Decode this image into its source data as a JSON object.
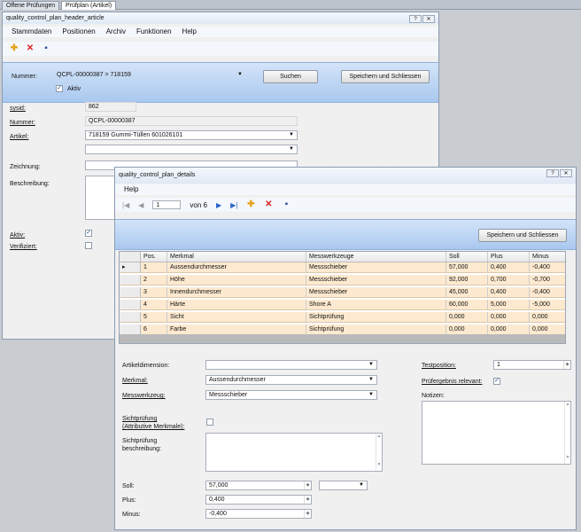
{
  "tabs": [
    {
      "label": "Offene Prüfungen"
    },
    {
      "label": "Prüfplan (Artikel)"
    }
  ],
  "header_window": {
    "title": "quality_control_plan_header_article",
    "title_buttons": [
      "?",
      "✕"
    ],
    "menu": [
      "Stammdaten",
      "Positionen",
      "Archiv",
      "Funktionen",
      "Help"
    ],
    "toolbar_icons": [
      "add-icon",
      "delete-icon",
      "save-icon"
    ],
    "nummer_label": "Nummer:",
    "nummer_value": "QCPL-00000387 > 718159",
    "aktiv_label": "Aktiv",
    "aktiv_checked": true,
    "search_button": "Suchen",
    "save_close_button": "Speichern und Schliessen",
    "form": {
      "sysid_label": "sysid:",
      "sysid_value": "862",
      "nummer_label": "Nummer:",
      "nummer_value": "QCPL-00000387",
      "artikel_label": "Artikel:",
      "artikel_value": "718159    Gummi-Tüllen 601026101",
      "artikel2_value": "",
      "zeichnung_label": "Zeichnung:",
      "beschreibung_label": "Beschreibung:",
      "aktiv_label": "Aktiv:",
      "aktiv_checked": true,
      "verifiziert_label": "Verifiziert:",
      "verifiziert_checked": false
    }
  },
  "details_window": {
    "title": "quality_control_plan_details",
    "title_buttons": [
      "?",
      "✕"
    ],
    "menu": [
      "Help"
    ],
    "navigator": {
      "first": "|◀",
      "prev": "◀",
      "position": "1",
      "of_label": "von 6",
      "next": "▶",
      "last": "▶|"
    },
    "toolbar_icons": [
      "add-icon",
      "delete-icon",
      "save-icon"
    ],
    "save_close_button": "Speichern und Schliessen",
    "grid": {
      "columns": [
        "Pos.",
        "Merkmal",
        "Messwerkzeuge",
        "Soll",
        "Plus",
        "Minus"
      ],
      "rows": [
        [
          "1",
          "Aussendurchmesser",
          "Messschieber",
          "57,000",
          "0,400",
          "-0,400"
        ],
        [
          "2",
          "Höhe",
          "Messschieber",
          "92,000",
          "0,700",
          "-0,700"
        ],
        [
          "3",
          "Innendurchmesser",
          "Messschieber",
          "45,000",
          "0,400",
          "-0,400"
        ],
        [
          "4",
          "Härte",
          "Shore A",
          "60,000",
          "5,000",
          "-5,000"
        ],
        [
          "5",
          "Sicht",
          "Sichtprüfung",
          "0,000",
          "0,000",
          "0,000"
        ],
        [
          "6",
          "Farbe",
          "Sichtprüfung",
          "0,000",
          "0,000",
          "0,000"
        ]
      ],
      "current_row_marker": "▸"
    },
    "form": {
      "artikeldimension_label": "Artikeldimension:",
      "artikeldimension_value": "",
      "merkmal_label": "Merkmal:",
      "merkmal_value": "Aussendurchmesser",
      "messwerkzeug_label": "Messwerkzeug:",
      "messwerkzeug_value": "Messschieber",
      "sichtpruefung_label": "Sichtprüfung\n(Attributive Merkmale):",
      "sichtpruefung_checked": false,
      "sichtpruefung_beschreibung_label": "Sichtprüfung\nbeschreibung:",
      "soll_label": "Soll:",
      "soll_value": "57,000",
      "soll_unit_value": "",
      "plus_label": "Plus:",
      "plus_value": "0,400",
      "minus_label": "Minus:",
      "minus_value": "-0,400",
      "testposition_label": "Testposition:",
      "testposition_value": "1",
      "pruefergebnis_label": "Prüfergebnis relevant:",
      "pruefergebnis_checked": true,
      "notizen_label": "Notizen:"
    }
  },
  "colors": {
    "grid_row_bg": "#fde9cf",
    "blue_band": "#b8d1f1",
    "delete_red": "#dd2222",
    "add_orange": "#e8a11a",
    "save_blue": "#2a4fa0"
  }
}
